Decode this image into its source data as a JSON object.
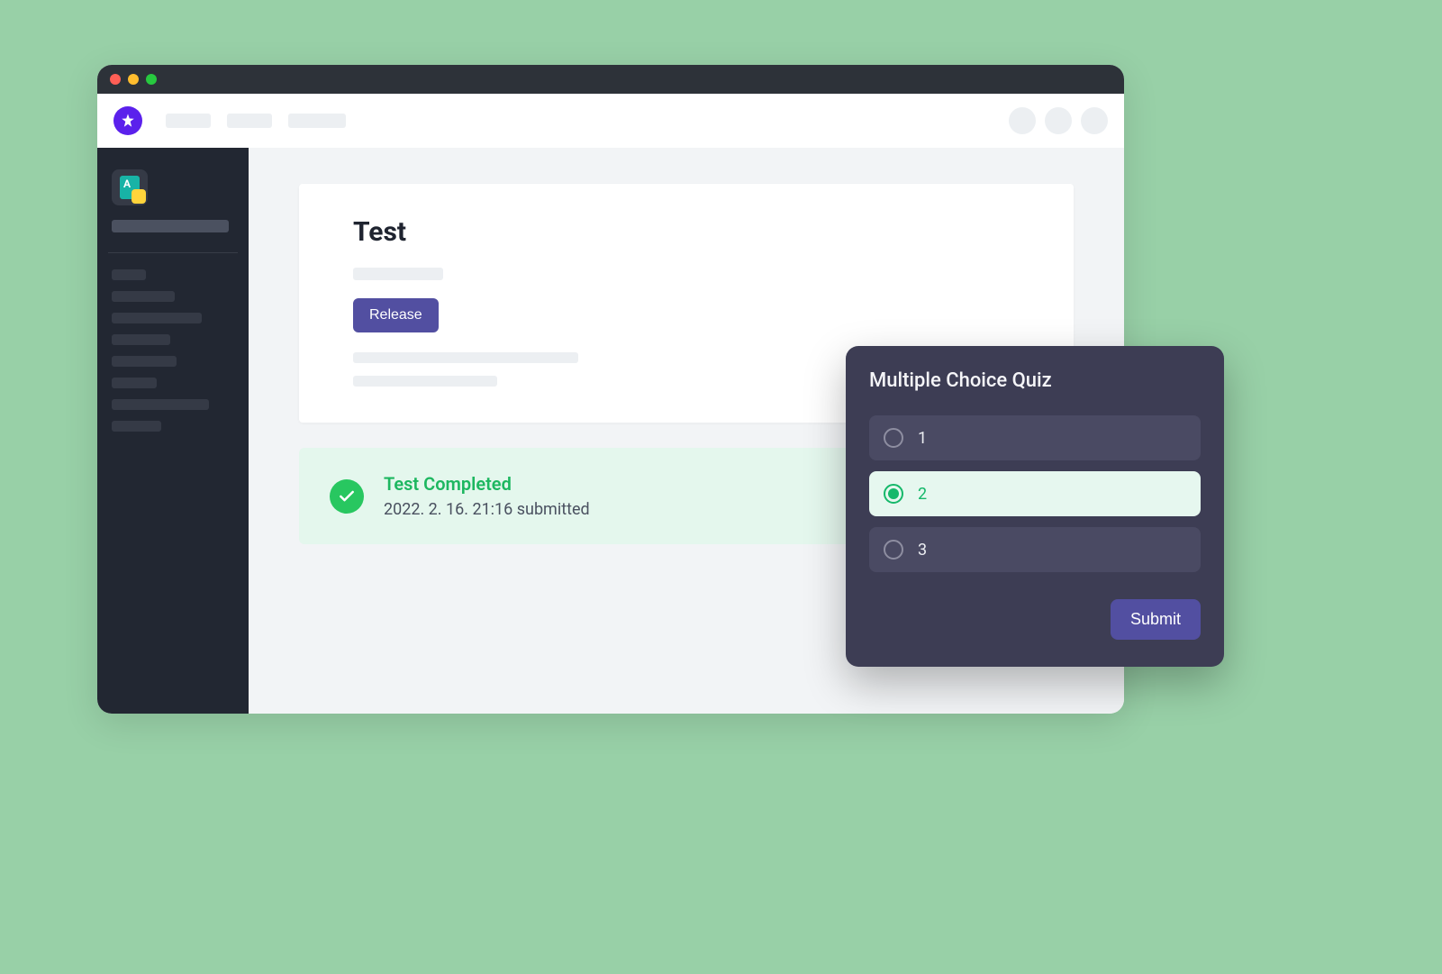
{
  "main": {
    "title": "Test",
    "release_button": "Release"
  },
  "status": {
    "heading": "Test Completed",
    "detail": "2022. 2. 16. 21:16 submitted"
  },
  "quiz": {
    "title": "Multiple Choice Quiz",
    "options": [
      "1",
      "2",
      "3"
    ],
    "selected_index": 1,
    "submit_label": "Submit"
  },
  "colors": {
    "accent": "#524fa1",
    "success": "#28c760",
    "background": "#98d0a7"
  }
}
